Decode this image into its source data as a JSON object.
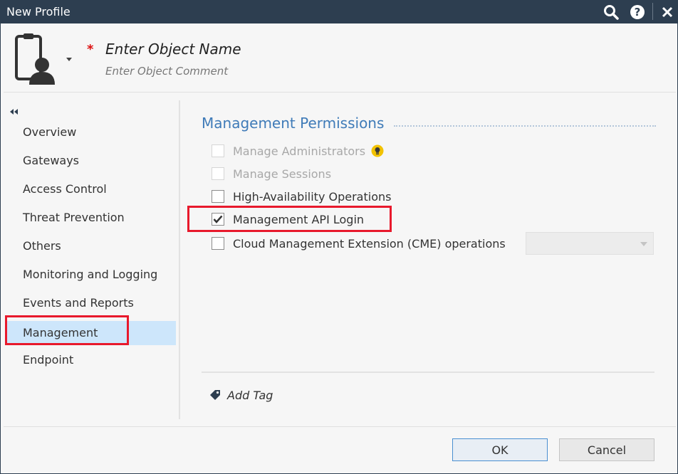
{
  "window": {
    "title": "New Profile"
  },
  "header": {
    "required_marker": "*",
    "name_placeholder": "Enter Object Name",
    "comment_placeholder": "Enter Object Comment"
  },
  "sidebar": {
    "items": [
      {
        "label": "Overview",
        "active": false
      },
      {
        "label": "Gateways",
        "active": false
      },
      {
        "label": "Access Control",
        "active": false
      },
      {
        "label": "Threat Prevention",
        "active": false
      },
      {
        "label": "Others",
        "active": false
      },
      {
        "label": "Monitoring and Logging",
        "active": false
      },
      {
        "label": "Events and Reports",
        "active": false
      },
      {
        "label": "Management",
        "active": true
      },
      {
        "label": "Endpoint",
        "active": false
      }
    ]
  },
  "main": {
    "section_title": "Management Permissions",
    "permissions": [
      {
        "label": "Manage Administrators",
        "checked": false,
        "enabled": false,
        "has_hint_icon": true
      },
      {
        "label": "Manage Sessions",
        "checked": false,
        "enabled": false
      },
      {
        "label": "High-Availability Operations",
        "checked": false,
        "enabled": true
      },
      {
        "label": "Management API Login",
        "checked": true,
        "enabled": true
      },
      {
        "label": "Cloud Management Extension (CME) operations",
        "checked": false,
        "enabled": true
      }
    ],
    "cme_select_value": "",
    "add_tag_label": "Add Tag"
  },
  "footer": {
    "ok_label": "OK",
    "cancel_label": "Cancel"
  },
  "colors": {
    "titlebar": "#2d3e50",
    "accent_title": "#3f7bb8",
    "active_nav": "#cde6fb",
    "highlight": "#e8192c",
    "hint_icon": "#f2c200"
  }
}
